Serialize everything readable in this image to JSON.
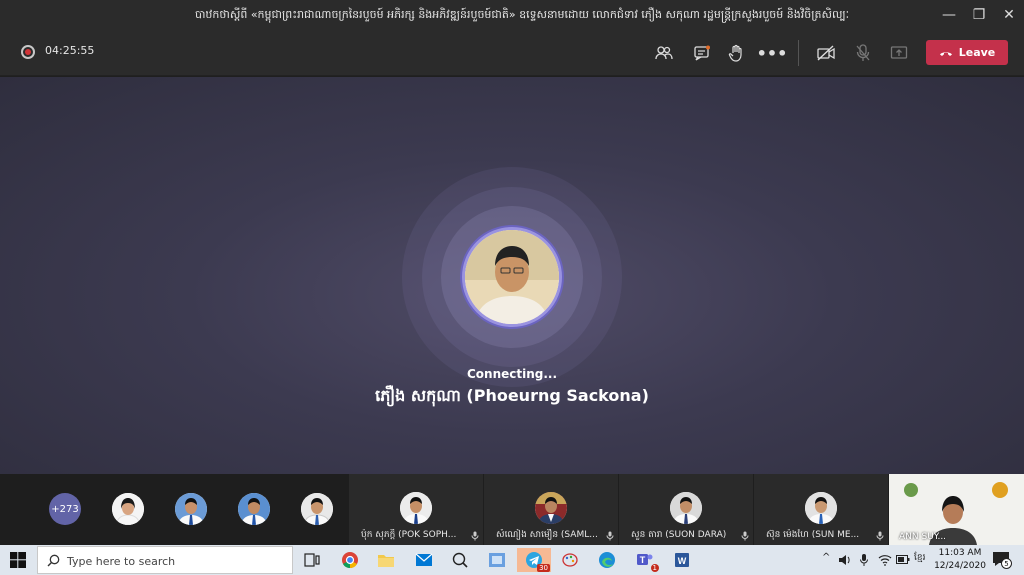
{
  "window": {
    "title": "បាឋកថាស្ដីពី «កម្ពុជាព្រះរាជាណាចក្រនៃរបួចម៍ អភិរក្ស និងអភិវឌ្ឍន៍របួចម៍ជាតិ» ឧទ្ទេសនាមដោយ លោកជំទាវ ភឿង សកុណា រដ្ឋមន្ត្រីក្រសួងរបួចម៍ និងវិចិត្រសិល្បៈ",
    "minimize": "—",
    "maximize": "❐",
    "close": "✕"
  },
  "toolbar": {
    "timer": "04:25:55",
    "leave_label": "Leave"
  },
  "stage": {
    "status": "Connecting...",
    "caller_name": "ភឿង សកុណា (Phoeurng Sackona)"
  },
  "participants": {
    "more_count": "+273",
    "tiles": [
      {
        "label": "ប៉ុក សុភក្ដិ (POK SOPH..."
      },
      {
        "label": "សំណៀង សាមឿន (SAML..."
      },
      {
        "label": "សួន តារា (SUON DARA)"
      },
      {
        "label": "ស៊ុន ម៉េងហៃ (SUN ME..."
      }
    ],
    "self_label": "ANN SUY..."
  },
  "taskbar": {
    "search_placeholder": "Type here to search",
    "telegram_badge": "30",
    "teams_badge": "1",
    "time": "11:03 AM",
    "date": "12/24/2020",
    "lang": "ខ្មែរ",
    "notifications": "5"
  },
  "colors": {
    "leave": "#c4314b",
    "teams_purple": "#6264a7",
    "record": "#d13438"
  }
}
